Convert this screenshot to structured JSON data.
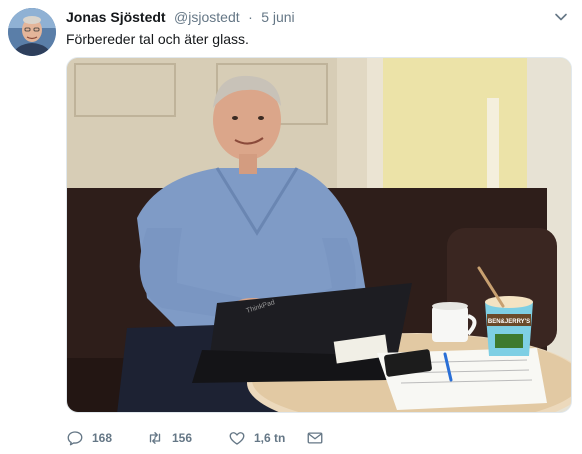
{
  "author": {
    "display_name": "Jonas Sjöstedt",
    "handle": "@jsjostedt",
    "separator": "·",
    "date": "5 juni"
  },
  "tweet": {
    "text": "Förbereder tal och äter glass."
  },
  "media": {
    "laptop_brand": "ThinkPad",
    "ice_cream_brand": "BEN&JERRY'S"
  },
  "actions": {
    "replies": "168",
    "retweets": "156",
    "likes": "1,6 tn"
  },
  "colors": {
    "text_primary": "#14171a",
    "text_secondary": "#657786",
    "icon": "#657786"
  },
  "icons": {
    "menu": "chevron-down-icon",
    "reply": "reply-icon",
    "retweet": "retweet-icon",
    "like": "heart-icon",
    "message": "envelope-icon"
  }
}
